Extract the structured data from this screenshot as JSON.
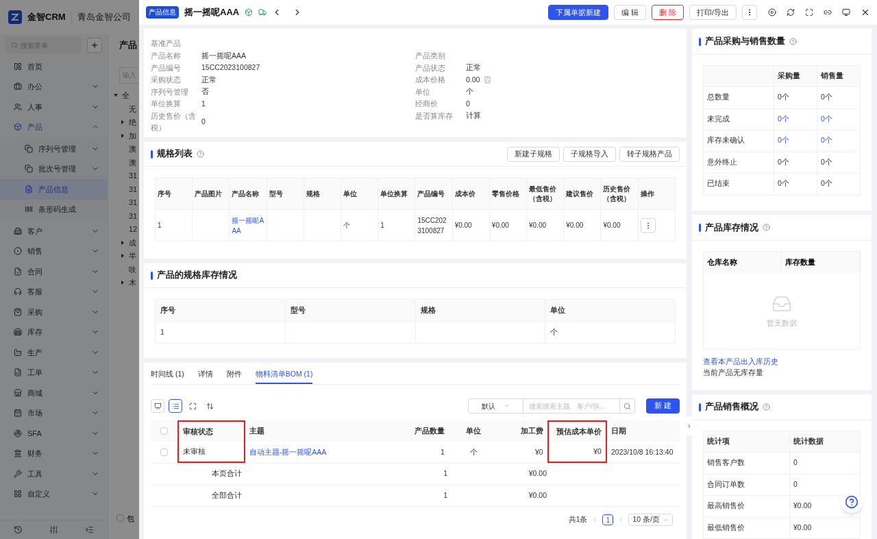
{
  "app": {
    "logo_text": "金智CRM",
    "company": "青岛金智公司"
  },
  "sidebar": {
    "search_placeholder": "搜索菜单",
    "items": [
      {
        "label": "首页",
        "kind": "link",
        "selected": false
      },
      {
        "label": "办公",
        "kind": "group",
        "expanded": false,
        "selected": false
      },
      {
        "label": "人事",
        "kind": "group",
        "expanded": false,
        "selected": false
      },
      {
        "label": "产品",
        "kind": "group",
        "expanded": true,
        "selected": true,
        "children": [
          {
            "label": "序列号管理",
            "kind": "group",
            "expanded": false,
            "selected": false
          },
          {
            "label": "批次号管理",
            "kind": "group",
            "expanded": false,
            "selected": false
          },
          {
            "label": "产品信息",
            "kind": "link",
            "selected": true
          },
          {
            "label": "条形码生成",
            "kind": "link",
            "selected": false
          }
        ]
      },
      {
        "label": "客户",
        "kind": "group",
        "expanded": false,
        "selected": false
      },
      {
        "label": "销售",
        "kind": "group",
        "expanded": false,
        "selected": false
      },
      {
        "label": "合同",
        "kind": "group",
        "expanded": false,
        "selected": false
      },
      {
        "label": "客服",
        "kind": "group",
        "expanded": false,
        "selected": false
      },
      {
        "label": "采购",
        "kind": "group",
        "expanded": false,
        "selected": false
      },
      {
        "label": "库存",
        "kind": "group",
        "expanded": false,
        "selected": false
      },
      {
        "label": "生产",
        "kind": "group",
        "expanded": false,
        "selected": false
      },
      {
        "label": "工单",
        "kind": "group",
        "expanded": false,
        "selected": false
      },
      {
        "label": "商城",
        "kind": "group",
        "expanded": false,
        "selected": false
      },
      {
        "label": "市场",
        "kind": "group",
        "expanded": false,
        "selected": false
      },
      {
        "label": "SFA",
        "kind": "group",
        "expanded": false,
        "selected": false
      },
      {
        "label": "财务",
        "kind": "group",
        "expanded": false,
        "selected": false
      },
      {
        "label": "工具",
        "kind": "group",
        "expanded": false,
        "selected": false
      },
      {
        "label": "自定义",
        "kind": "group",
        "expanded": false,
        "selected": false
      }
    ]
  },
  "tree_panel": {
    "title": "产品",
    "search_placeholder": "输入",
    "nodes": [
      {
        "label": "全",
        "kind": "folder",
        "expanded": true,
        "children": [
          {
            "label": "无",
            "kind": "leaf"
          },
          {
            "label": "绝",
            "kind": "folder",
            "expanded": false
          },
          {
            "label": "加",
            "kind": "folder",
            "expanded": false
          },
          {
            "label": "澳",
            "kind": "leaf"
          },
          {
            "label": "澳",
            "kind": "leaf"
          },
          {
            "label": "31",
            "kind": "leaf"
          },
          {
            "label": "31",
            "kind": "leaf"
          },
          {
            "label": "31",
            "kind": "leaf"
          },
          {
            "label": "31",
            "kind": "leaf"
          },
          {
            "label": "12",
            "kind": "leaf"
          },
          {
            "label": "成",
            "kind": "folder",
            "expanded": false
          },
          {
            "label": "半",
            "kind": "folder",
            "expanded": false
          },
          {
            "label": "吱",
            "kind": "leaf"
          },
          {
            "label": "木",
            "kind": "folder",
            "expanded": false
          }
        ]
      }
    ],
    "footer_checkbox": {
      "label": "包",
      "checked": false
    }
  },
  "drawer": {
    "badge": "产品信息",
    "title": "摇一摇呢AAA",
    "buttons": [
      {
        "label": "下属单据新建",
        "kind": "primary"
      },
      {
        "label": "编 辑",
        "kind": "default"
      },
      {
        "label": "删 除",
        "kind": "danger"
      },
      {
        "label": "打印/导出",
        "kind": "default"
      }
    ],
    "basic_info": {
      "section_label": "基准产品",
      "left": [
        {
          "label": "产品名称",
          "value": "摇一摇呢AAA"
        },
        {
          "label": "产品编号",
          "value": "15CC2023100827"
        },
        {
          "label": "采购状态",
          "value": "正常"
        },
        {
          "label": "序列号管理",
          "value": "否"
        },
        {
          "label": "单位换算",
          "value": "1"
        },
        {
          "label": "历史售价（含税）",
          "value": "0"
        }
      ],
      "right": [
        {
          "label": "产品类别"
        },
        {
          "label": "产品状态",
          "value": "正常"
        },
        {
          "label": "成本价格",
          "value": "0.00",
          "calculator": true
        },
        {
          "label": "单位",
          "value": "个"
        },
        {
          "label": "经商价",
          "value": "0"
        },
        {
          "label": "是否算库存",
          "value": "计算"
        }
      ]
    },
    "spec_list": {
      "title": "规格列表",
      "buttons": [
        "新建子规格",
        "子规格导入",
        "转子规格产品"
      ],
      "columns": [
        {
          "label": "序号",
          "kind": "text"
        },
        {
          "label": "产品图片",
          "kind": "text"
        },
        {
          "label": "产品名称",
          "kind": "link"
        },
        {
          "label": "型号",
          "kind": "text"
        },
        {
          "label": "规格",
          "kind": "text"
        },
        {
          "label": "单位",
          "kind": "text"
        },
        {
          "label": "单位换算",
          "kind": "text"
        },
        {
          "label": "产品编号",
          "kind": "text"
        },
        {
          "label": "成本价",
          "kind": "text"
        },
        {
          "label": "零售价格",
          "kind": "text"
        },
        {
          "label": "最低售价（含税）",
          "kind": "text"
        },
        {
          "label": "建议售价",
          "kind": "text"
        },
        {
          "label": "历史售价（含税）",
          "kind": "text"
        },
        {
          "label": "操作",
          "kind": "action"
        }
      ],
      "rows": [
        [
          "1",
          null,
          "摇一摇呢AAA",
          null,
          null,
          "个",
          "1",
          "15CC2023100827",
          "¥0.00",
          "¥0.00",
          "¥0.00",
          "¥0.00",
          "¥0.00",
          null
        ]
      ]
    },
    "stock_spec": {
      "title": "产品的规格库存情况",
      "columns": [
        "序号",
        "型号",
        "规格",
        "单位"
      ],
      "rows": [
        [
          "1",
          null,
          null,
          "个"
        ]
      ]
    },
    "tabs": [
      {
        "label": "时间线 (1)",
        "selected": false
      },
      {
        "label": "详情",
        "selected": false
      },
      {
        "label": "附件",
        "selected": false
      },
      {
        "label": "物料清单BOM (1)",
        "selected": true
      }
    ],
    "view_toggle": [
      {
        "selected": false
      },
      {
        "selected": true
      }
    ],
    "filter": {
      "select": "默认",
      "search_placeholder": "搜索搜索主题、客户/供...",
      "new_button": "新 建"
    },
    "bom_table": {
      "header_checked": false,
      "columns": [
        {
          "label": "审核状态",
          "highlighted": true
        },
        {
          "label": "主题",
          "highlighted": false
        },
        {
          "label": "产品数量",
          "highlighted": false
        },
        {
          "label": "单位",
          "highlighted": false
        },
        {
          "label": "加工费",
          "highlighted": false
        },
        {
          "label": "预估成本单价",
          "highlighted": true
        },
        {
          "label": "日期",
          "highlighted": false
        }
      ],
      "rows": [
        {
          "checked": false,
          "cells": [
            "未审核",
            "自动主题-摇一摇呢AAA",
            "1",
            "个",
            "¥0",
            "¥0",
            "2023/10/8 16:13:40"
          ]
        }
      ],
      "totals": [
        {
          "label": "本页合计",
          "quantity": "1",
          "fee": "¥0.00"
        },
        {
          "label": "全部合计",
          "quantity": "1",
          "fee": "¥0.00"
        }
      ]
    },
    "pagination": {
      "total": "共1条",
      "page": "1",
      "page_size": "10 条/页"
    }
  },
  "purchase_sales": {
    "title": "产品采购与销售数量",
    "columns": [
      "采购量",
      "销售量"
    ],
    "rows": [
      {
        "label": "总数量",
        "values": [
          "0个",
          "0个"
        ],
        "link": false
      },
      {
        "label": "未完成",
        "values": [
          "0个",
          "0个"
        ],
        "link": true
      },
      {
        "label": "库存未确认",
        "values": [
          "0个",
          "0个"
        ],
        "link": true
      },
      {
        "label": "意外终止",
        "values": [
          "0个",
          "0个"
        ],
        "link": false
      },
      {
        "label": "已结束",
        "values": [
          "0个",
          "0个"
        ],
        "link": false
      }
    ]
  },
  "stock": {
    "title": "产品库存情况",
    "columns": [
      "仓库名称",
      "库存数量"
    ],
    "empty_text": "暂无数据",
    "history_link": "查看本产品出入库历史",
    "note": "当前产品无库存量"
  },
  "sales_overview": {
    "title": "产品销售概况",
    "columns": [
      "统计项",
      "统计数据"
    ],
    "rows": [
      [
        "销售客户数",
        "0"
      ],
      [
        "合同订单数",
        "0"
      ],
      [
        "最高销售价",
        "¥0.00"
      ],
      [
        "最低销售价",
        "¥0.00"
      ]
    ]
  }
}
